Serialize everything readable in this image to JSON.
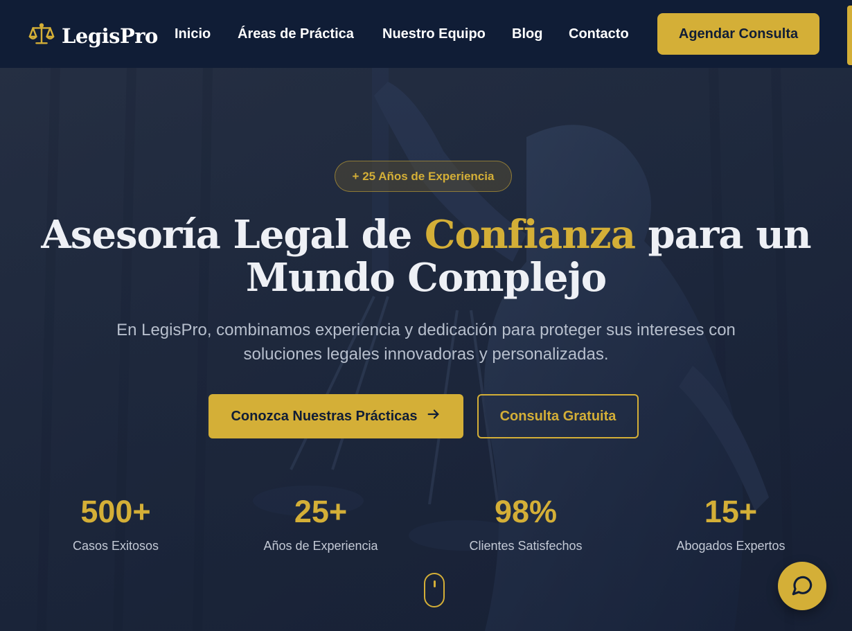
{
  "brand": {
    "name": "LegisPro",
    "icon": "scales-icon"
  },
  "nav": {
    "links": [
      "Inicio",
      "Áreas de Práctica",
      "Nuestro Equipo",
      "Blog",
      "Contacto"
    ],
    "cta": "Agendar Consulta"
  },
  "hero": {
    "badge": "+ 25 Años de Experiencia",
    "headline_before": "Asesoría Legal de ",
    "headline_highlight": "Confianza",
    "headline_after": " para un Mundo Complejo",
    "subtitle": "En LegisPro, combinamos experiencia y dedicación para proteger sus intereses con soluciones legales innovadoras y personalizadas.",
    "primary_button": "Conozca Nuestras Prácticas",
    "secondary_button": "Consulta Gratuita",
    "background_image": "lady-justice-statue"
  },
  "stats": [
    {
      "value": "500+",
      "label": "Casos Exitosos"
    },
    {
      "value": "25+",
      "label": "Años de Experiencia"
    },
    {
      "value": "98%",
      "label": "Clientes Satisfechos"
    },
    {
      "value": "15+",
      "label": "Abogados Expertos"
    }
  ],
  "colors": {
    "navy": "#101d36",
    "gold": "#d4af37",
    "hero_bg": "#1a2438"
  },
  "icons": {
    "arrow": "arrow-right-icon",
    "scroll": "mouse-scroll-icon",
    "chat": "chat-bubble-icon"
  }
}
